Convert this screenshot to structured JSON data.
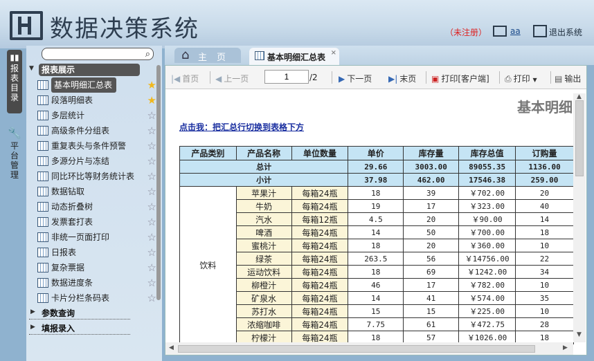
{
  "app": {
    "title": "数据决策系统",
    "unregistered": "（未注册）",
    "user": "aa",
    "logout": "退出系统"
  },
  "vtabs": {
    "report_dir": "报表目录",
    "platform": "平台管理"
  },
  "sidebar": {
    "search_placeholder": "",
    "group_reports": "报表展示",
    "items": [
      {
        "label": "基本明细汇总表",
        "starred": true,
        "selected": true
      },
      {
        "label": "段落明细表",
        "starred": true,
        "selected": false
      },
      {
        "label": "多层统计",
        "starred": false,
        "selected": false
      },
      {
        "label": "高级条件分组表",
        "starred": false,
        "selected": false
      },
      {
        "label": "重复表头与条件预警",
        "starred": false,
        "selected": false
      },
      {
        "label": "多源分片与冻结",
        "starred": false,
        "selected": false
      },
      {
        "label": "同比环比等财务统计表",
        "starred": false,
        "selected": false
      },
      {
        "label": "数据钻取",
        "starred": false,
        "selected": false
      },
      {
        "label": "动态折叠树",
        "starred": false,
        "selected": false
      },
      {
        "label": "发票套打表",
        "starred": false,
        "selected": false
      },
      {
        "label": "非统一页面打印",
        "starred": false,
        "selected": false
      },
      {
        "label": "日报表",
        "starred": false,
        "selected": false
      },
      {
        "label": "复杂票据",
        "starred": false,
        "selected": false
      },
      {
        "label": "数据进度条",
        "starred": false,
        "selected": false
      },
      {
        "label": "卡片分栏条码表",
        "starred": false,
        "selected": false
      }
    ],
    "group_params": "参数查询",
    "group_entry": "填报录入"
  },
  "tabs": {
    "home": "主页",
    "current": "基本明细汇总表",
    "close": "×"
  },
  "toolbar": {
    "first": "首页",
    "prev": "上一页",
    "page": "1",
    "total": "/2",
    "next": "下一页",
    "last": "末页",
    "print_client": "打印[客户端]",
    "print": "打印",
    "export": "输出"
  },
  "report": {
    "title": "基本明细",
    "switch_link": "点击我：把汇总行切换到表格下方",
    "headers": [
      "产品类别",
      "产品名称",
      "单位数量",
      "单价",
      "库存量",
      "库存总值",
      "订购量"
    ],
    "total": {
      "label": "总计",
      "price": "29.66",
      "stock": "3003.00",
      "value": "89055.35",
      "order": "1136.00"
    },
    "subtotal": {
      "label": "小计",
      "price": "37.98",
      "stock": "462.00",
      "value": "17546.38",
      "order": "259.00"
    },
    "category": "饮料",
    "rows": [
      [
        "苹果汁",
        "每箱24瓶",
        "18",
        "39",
        "￥702.00",
        "20"
      ],
      [
        "牛奶",
        "每箱24瓶",
        "19",
        "17",
        "￥323.00",
        "40"
      ],
      [
        "汽水",
        "每箱12瓶",
        "4.5",
        "20",
        "￥90.00",
        "14"
      ],
      [
        "啤酒",
        "每箱24瓶",
        "14",
        "50",
        "￥700.00",
        "18"
      ],
      [
        "蜜桃汁",
        "每箱24瓶",
        "18",
        "20",
        "￥360.00",
        "10"
      ],
      [
        "绿茶",
        "每箱24瓶",
        "263.5",
        "56",
        "￥14756.00",
        "22"
      ],
      [
        "运动饮料",
        "每箱24瓶",
        "18",
        "69",
        "￥1242.00",
        "34"
      ],
      [
        "柳橙汁",
        "每箱24瓶",
        "46",
        "17",
        "￥782.00",
        "10"
      ],
      [
        "矿泉水",
        "每箱24瓶",
        "14",
        "41",
        "￥574.00",
        "35"
      ],
      [
        "苏打水",
        "每箱24瓶",
        "15",
        "15",
        "￥225.00",
        "10"
      ],
      [
        "浓缩咖啡",
        "每箱24瓶",
        "7.75",
        "61",
        "￥472.75",
        "28"
      ],
      [
        "柠檬汁",
        "每箱24瓶",
        "18",
        "57",
        "￥1026.00",
        "18"
      ]
    ]
  }
}
